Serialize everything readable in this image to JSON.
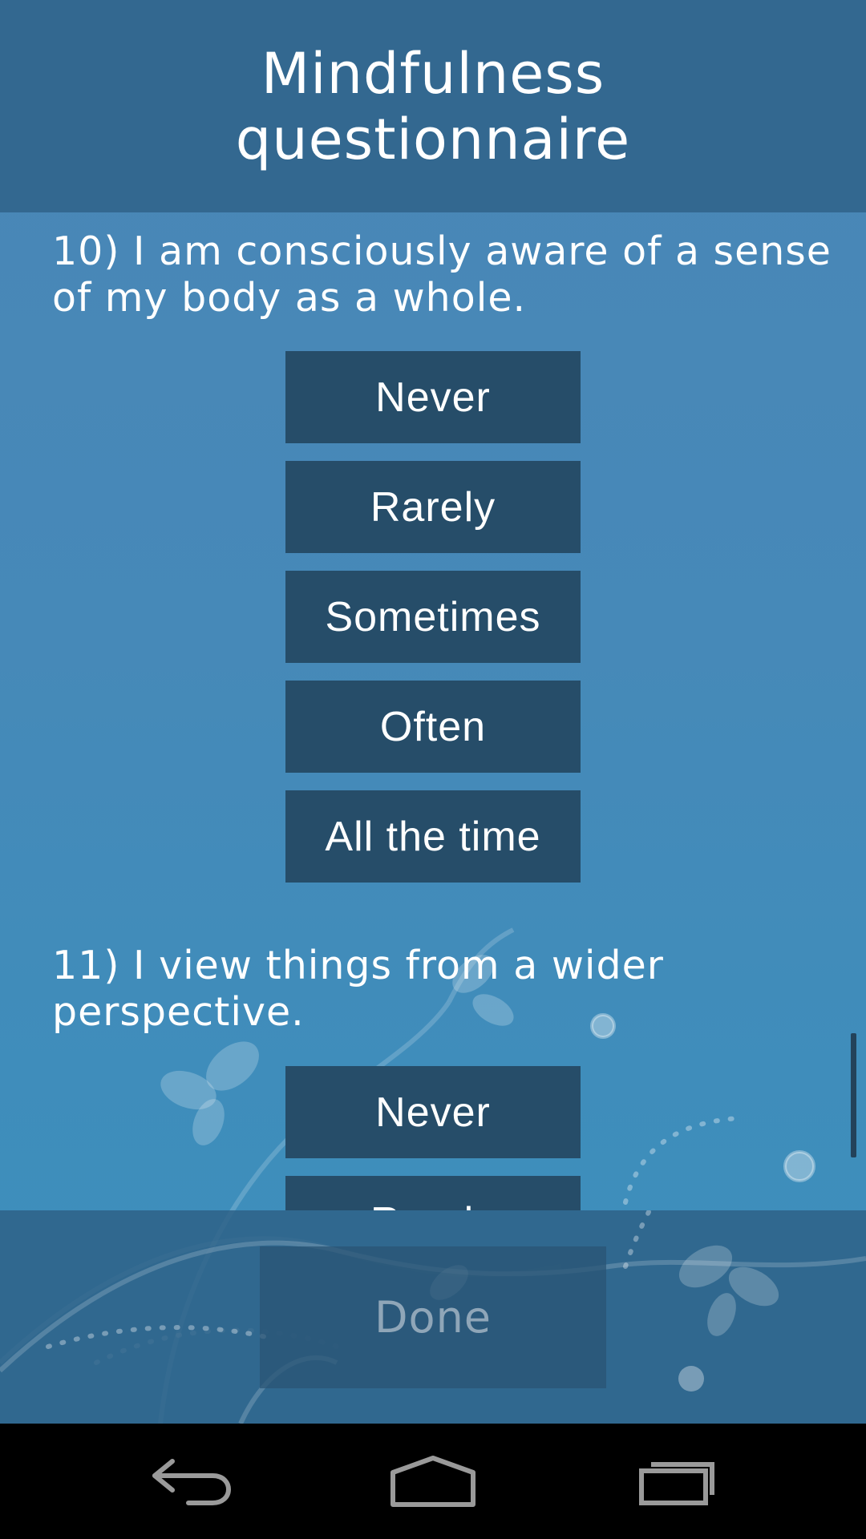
{
  "header": {
    "title": "Mindfulness questionnaire"
  },
  "questions": [
    {
      "text": "10) I am consciously aware of a sense of my body as a whole.",
      "options": [
        "Never",
        "Rarely",
        "Sometimes",
        "Often",
        "All the time"
      ]
    },
    {
      "text": "11) I view things from a wider perspective.",
      "options": [
        "Never",
        "Rarely"
      ]
    }
  ],
  "footer": {
    "done_label": "Done"
  },
  "navbar": {
    "back_icon": "back-icon",
    "home_icon": "home-icon",
    "recents_icon": "recents-icon"
  },
  "colors": {
    "header_bg": "#336890",
    "content_bg": "#4689b8",
    "button_bg": "#264d69",
    "button_text": "#ffffff",
    "done_text": "#8fa6b8"
  }
}
